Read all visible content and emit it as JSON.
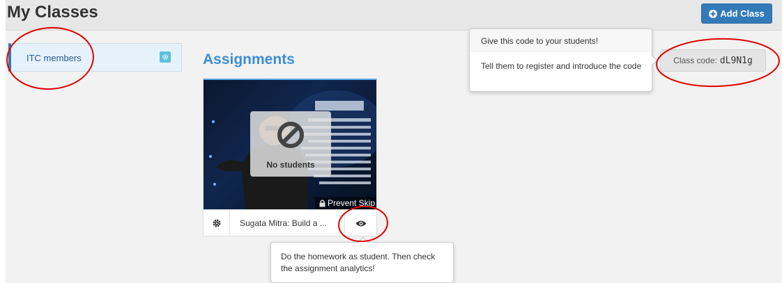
{
  "header": {
    "title": "My Classes",
    "add_class_label": "Add Class",
    "add_class_icon": "plus-circle-icon"
  },
  "sidebar": {
    "classes": [
      {
        "label": "ITC members",
        "selected": true,
        "settings_icon": "gear-icon"
      }
    ]
  },
  "main": {
    "section_title": "Assignments",
    "assignments": [
      {
        "title": "Sugata Mitra: Build a ...",
        "overlay_status": "No students",
        "overlay_icon": "ban-icon",
        "prevent_skip_label": "Prevent Skip",
        "prevent_skip_icon": "lock-icon",
        "settings_icon": "gear-icon",
        "preview_icon": "eye-icon"
      }
    ]
  },
  "class_code": {
    "label": "Class code:",
    "value": "dL9N1g"
  },
  "popovers": {
    "class_code_hint": {
      "title": "Give this code to your students!",
      "body": "Tell them to register and introduce the code"
    },
    "homework_hint": {
      "body": "Do the homework as student. Then check the assignment analytics!"
    }
  },
  "colors": {
    "accent": "#337ab7",
    "section_title": "#3c8dd8",
    "annotation": "#e00000"
  }
}
